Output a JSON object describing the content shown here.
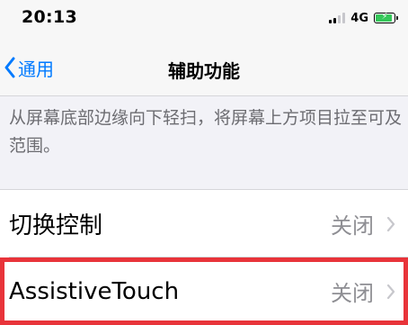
{
  "status_bar": {
    "time": "20:13",
    "network": "4G",
    "battery_charging_symbol": "⚡"
  },
  "nav": {
    "back_label": "通用",
    "title": "辅助功能"
  },
  "description": "从屏幕底部边缘向下轻扫，将屏幕上方项目拉至可及范围。",
  "rows": [
    {
      "label": "切换控制",
      "value": "关闭"
    },
    {
      "label": "AssistiveTouch",
      "value": "关闭"
    }
  ],
  "colors": {
    "accent": "#007aff",
    "highlight": "#e8343a",
    "battery": "#34c759"
  }
}
